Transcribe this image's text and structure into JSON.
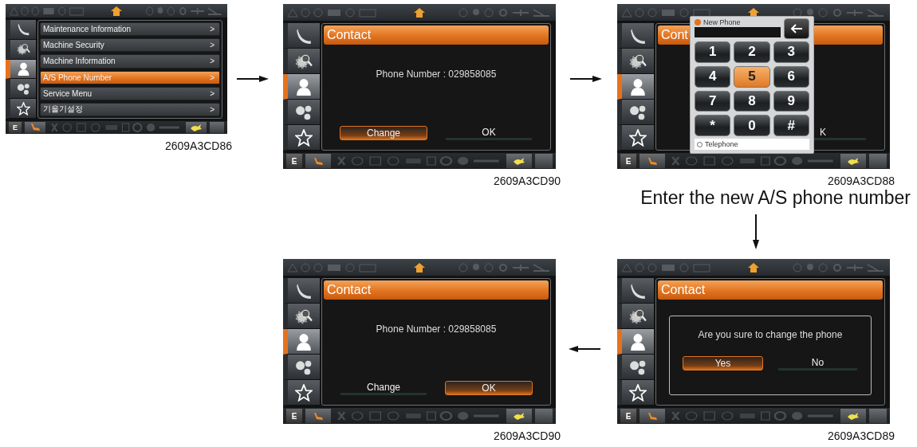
{
  "screens": [
    {
      "kind": "menu",
      "caption": "2609A3CD86",
      "mode_key": "E",
      "sidebar": [
        {
          "selected": false
        },
        {
          "selected": false
        },
        {
          "selected": true
        },
        {
          "selected": false
        },
        {
          "selected": false
        }
      ],
      "items": [
        {
          "label": "Maintenance Information",
          "chevron": ">",
          "selected": false
        },
        {
          "label": "Machine Security",
          "chevron": ">",
          "selected": false
        },
        {
          "label": "Machine Information",
          "chevron": ">",
          "selected": false
        },
        {
          "label": "A/S Phone Number",
          "chevron": ">",
          "selected": true
        },
        {
          "label": "Service Menu",
          "chevron": ">",
          "selected": false
        },
        {
          "label": "기울기설정",
          "chevron": ">",
          "selected": false
        }
      ]
    },
    {
      "kind": "contact",
      "caption": "2609A3CD90",
      "mode_key": "E",
      "sidebar": [
        {
          "selected": false
        },
        {
          "selected": false
        },
        {
          "selected": true
        },
        {
          "selected": false
        },
        {
          "selected": false
        }
      ],
      "title": "Contact",
      "message": "Phone Number : 029858085",
      "buttons": [
        {
          "label": "Change",
          "selected": true
        },
        {
          "label": "OK",
          "selected": false
        }
      ]
    },
    {
      "kind": "keypad",
      "caption": "2609A3CD88",
      "mode_key": "E",
      "sidebar": [
        {
          "selected": false
        },
        {
          "selected": false
        },
        {
          "selected": true
        },
        {
          "selected": false
        },
        {
          "selected": false
        }
      ],
      "title": "Cont",
      "buttons": [
        {
          "label": "K",
          "selected": false
        }
      ],
      "keypad": {
        "label": "New Phone",
        "footer": "Telephone",
        "keys": [
          {
            "label": "1",
            "selected": false
          },
          {
            "label": "2",
            "selected": false
          },
          {
            "label": "3",
            "selected": false
          },
          {
            "label": "4",
            "selected": false
          },
          {
            "label": "5",
            "selected": true
          },
          {
            "label": "6",
            "selected": false
          },
          {
            "label": "7",
            "selected": false
          },
          {
            "label": "8",
            "selected": false
          },
          {
            "label": "9",
            "selected": false
          },
          {
            "label": "*",
            "selected": false
          },
          {
            "label": "0",
            "selected": false
          },
          {
            "label": "#",
            "selected": false
          }
        ]
      }
    },
    {
      "kind": "contact",
      "caption": "2609A3CD90",
      "mode_key": "E",
      "sidebar": [
        {
          "selected": false
        },
        {
          "selected": false
        },
        {
          "selected": true
        },
        {
          "selected": false
        },
        {
          "selected": false
        }
      ],
      "title": "Contact",
      "message": "Phone Number : 029858085",
      "buttons": [
        {
          "label": "Change",
          "selected": false
        },
        {
          "label": "OK",
          "selected": true
        }
      ]
    },
    {
      "kind": "confirm",
      "caption": "2609A3CD89",
      "mode_key": "E",
      "sidebar": [
        {
          "selected": false
        },
        {
          "selected": false
        },
        {
          "selected": true
        },
        {
          "selected": false
        },
        {
          "selected": false
        }
      ],
      "title": "Contact",
      "message": "Are you sure to change the phone",
      "buttons": [
        {
          "label": "Yes",
          "selected": true
        },
        {
          "label": "No",
          "selected": false
        }
      ]
    }
  ],
  "instruction": "Enter the new A/S phone number"
}
